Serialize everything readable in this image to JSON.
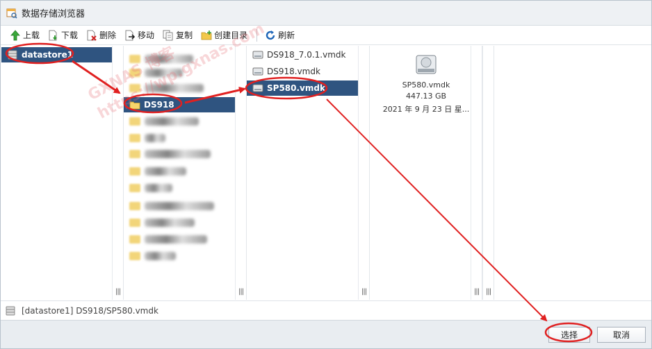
{
  "window": {
    "title": "数据存储浏览器",
    "app_icon": "datastore-browser-icon"
  },
  "toolbar": {
    "items": [
      {
        "label": "上载",
        "icon": "upload-arrow-icon"
      },
      {
        "label": "下载",
        "icon": "download-file-icon"
      },
      {
        "label": "删除",
        "icon": "delete-file-icon"
      },
      {
        "label": "移动",
        "icon": "move-file-icon"
      },
      {
        "label": "复制",
        "icon": "copy-file-icon"
      },
      {
        "label": "创建目录",
        "icon": "new-folder-icon"
      },
      {
        "label": "刷新",
        "icon": "refresh-icon"
      }
    ]
  },
  "columns": {
    "datastores": {
      "items": [
        {
          "label": "datastore1",
          "selected": true,
          "icon": "datastore-icon"
        }
      ]
    },
    "folders": {
      "selected": {
        "label": "DS918",
        "icon": "folder-icon"
      }
    },
    "files": {
      "items": [
        {
          "label": "DS918_7.0.1.vmdk",
          "selected": false,
          "icon": "disk-icon"
        },
        {
          "label": "DS918.vmdk",
          "selected": false,
          "icon": "disk-icon"
        },
        {
          "label": "SP580.vmdk",
          "selected": true,
          "icon": "disk-icon"
        }
      ]
    },
    "preview": {
      "icon": "hard-disk-icon",
      "name": "SP580.vmdk",
      "size": "447.13 GB",
      "date": "2021 年 9 月 23 日 星..."
    }
  },
  "pathbar": {
    "path": "[datastore1] DS918/SP580.vmdk",
    "icon": "datastore-icon"
  },
  "footer": {
    "select_label": "选择",
    "cancel_label": "取消"
  },
  "watermark": {
    "lines": [
      "GXNAS 博客",
      "https://wp.gxnas.com"
    ]
  },
  "colors": {
    "selection": "#2f5480",
    "annotation": "#e02020",
    "titlebar": "#eef1f4",
    "footer": "#e9edf1"
  }
}
